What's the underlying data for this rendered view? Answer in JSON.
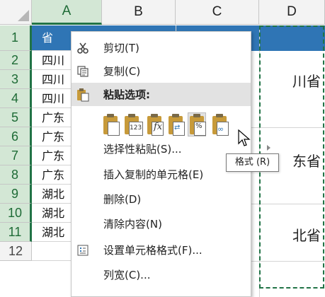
{
  "columns": [
    "A",
    "B",
    "C",
    "D"
  ],
  "rows": [
    "1",
    "2",
    "3",
    "4",
    "5",
    "6",
    "7",
    "8",
    "9",
    "10",
    "11",
    "12"
  ],
  "colA_values": [
    "省",
    "四川",
    "四川",
    "四川",
    "广东",
    "广东",
    "广东",
    "广东",
    "湖北",
    "湖北",
    "湖北",
    ""
  ],
  "merged_cells": [
    "川省",
    "东省",
    "北省"
  ],
  "context_menu": {
    "cut": "剪切(T)",
    "copy": "复制(C)",
    "paste_options": "粘贴选项:",
    "paste_icon_tags": [
      "",
      "123",
      "fx",
      "",
      "%",
      ""
    ],
    "paste_special": "选择性粘贴(S)...",
    "insert_copied": "插入复制的单元格(E)",
    "delete": "删除(D)",
    "clear_contents": "清除内容(N)",
    "format_cells": "设置单元格格式(F)...",
    "column_width": "列宽(C)..."
  },
  "tooltip": "格式 (R)",
  "colors": {
    "accent_green": "#217346",
    "header_blue": "#2f75b5",
    "paste_gold": "#c79a3a"
  }
}
